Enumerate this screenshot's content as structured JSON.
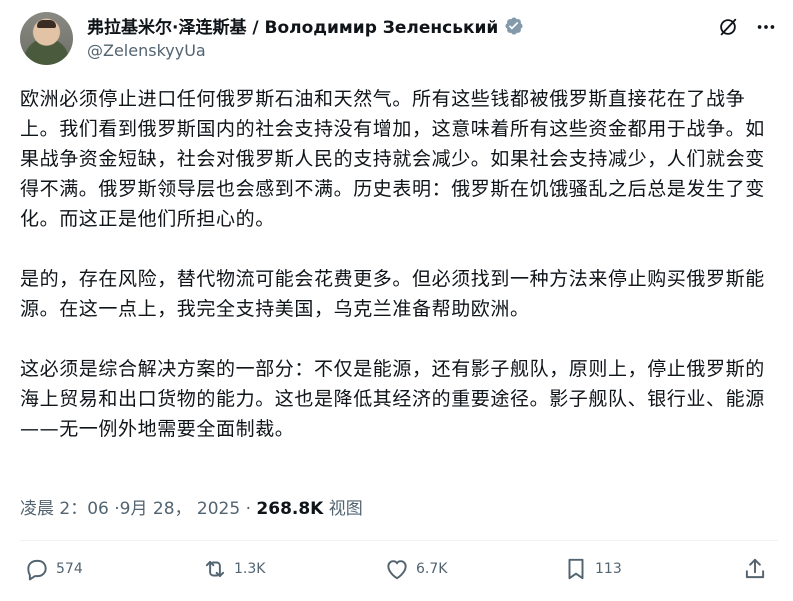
{
  "author": {
    "display_name": "弗拉基米尔·泽连斯基 / Володимир Зеленський",
    "handle": "@ZelenskyyUa",
    "verified_color": "#829aab"
  },
  "post": {
    "paragraphs": [
      "欧洲必须停止进口任何俄罗斯石油和天然气。所有这些钱都被俄罗斯直接花在了战争上。我们看到俄罗斯国内的社会支持没有增加，这意味着所有这些资金都用于战争。如果战争资金短缺，社会对俄罗斯人民的支持就会减少。如果社会支持减少，人们就会变得不满。俄罗斯领导层也会感到不满。历史表明：俄罗斯在饥饿骚乱之后总是发生了变化。而这正是他们所担心的。",
      "是的，存在风险，替代物流可能会花费更多。但必须找到一种方法来停止购买俄罗斯能源。在这一点上，我完全支持美国，乌克兰准备帮助欧洲。",
      "这必须是综合解决方案的一部分：不仅是能源，还有影子舰队，原则上，停止俄罗斯的海上贸易和出口货物的能力。这也是降低其经济的重要途径。影子舰队、银行业、能源——无一例外地需要全面制裁。"
    ],
    "timestamp": "凌晨 2：06 ·9月 28， 2025",
    "separator": " · ",
    "views_count": "268.8K",
    "views_label": " 视图"
  },
  "actions": {
    "replies": "574",
    "reposts": "1.3K",
    "likes": "6.7K",
    "bookmarks": "113"
  },
  "icons": {
    "header": [
      "grok-icon",
      "more-icon"
    ],
    "actions": [
      "reply-icon",
      "repost-icon",
      "like-icon",
      "bookmark-icon",
      "share-icon"
    ]
  },
  "colors": {
    "text": "#0f1419",
    "secondary": "#536471",
    "divider": "#eff3f4"
  }
}
